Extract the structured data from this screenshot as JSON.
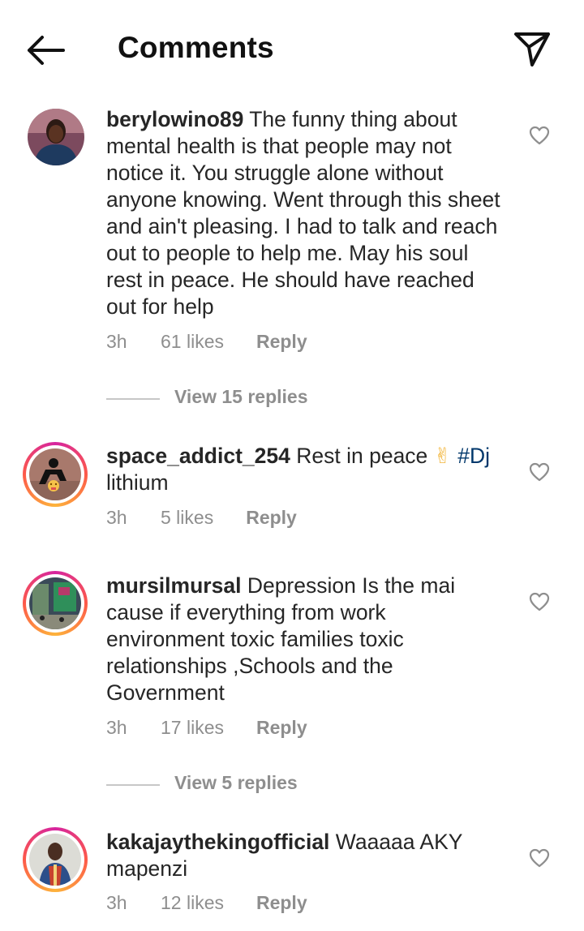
{
  "header": {
    "title": "Comments",
    "back_icon": "arrow-left-icon",
    "share_icon": "paper-plane-icon"
  },
  "comments": [
    {
      "username": "berylowino89",
      "text": "The funny thing about mental health is that people may not notice it. You struggle alone without anyone knowing. Went through this sheet and ain't pleasing. I had to talk and reach out to people to help me. May his soul rest in peace. He should have reached out for help",
      "time": "3h",
      "likes": "61 likes",
      "reply": "Reply",
      "view_replies": "View 15 replies"
    },
    {
      "username": "space_addict_254",
      "text": "Rest in peace",
      "emoji": "✌",
      "hashtag": "#Dj",
      "text_after": "lithium",
      "time": "3h",
      "likes": "5 likes",
      "reply": "Reply"
    },
    {
      "username": "mursilmursal",
      "text": "Depression Is the mai cause if everything from work environment toxic families toxic relationships ,Schools  and the Government",
      "time": "3h",
      "likes": "17 likes",
      "reply": "Reply",
      "view_replies": "View 5 replies"
    },
    {
      "username": "kakajaythekingofficial",
      "text": "Waaaaa AKY mapenzi",
      "time": "3h",
      "likes": "12 likes",
      "reply": "Reply"
    }
  ],
  "colors": {
    "text": "#262626",
    "secondary": "#8e8e8e",
    "hashtag": "#00376b",
    "divider": "#c7c7c7"
  }
}
